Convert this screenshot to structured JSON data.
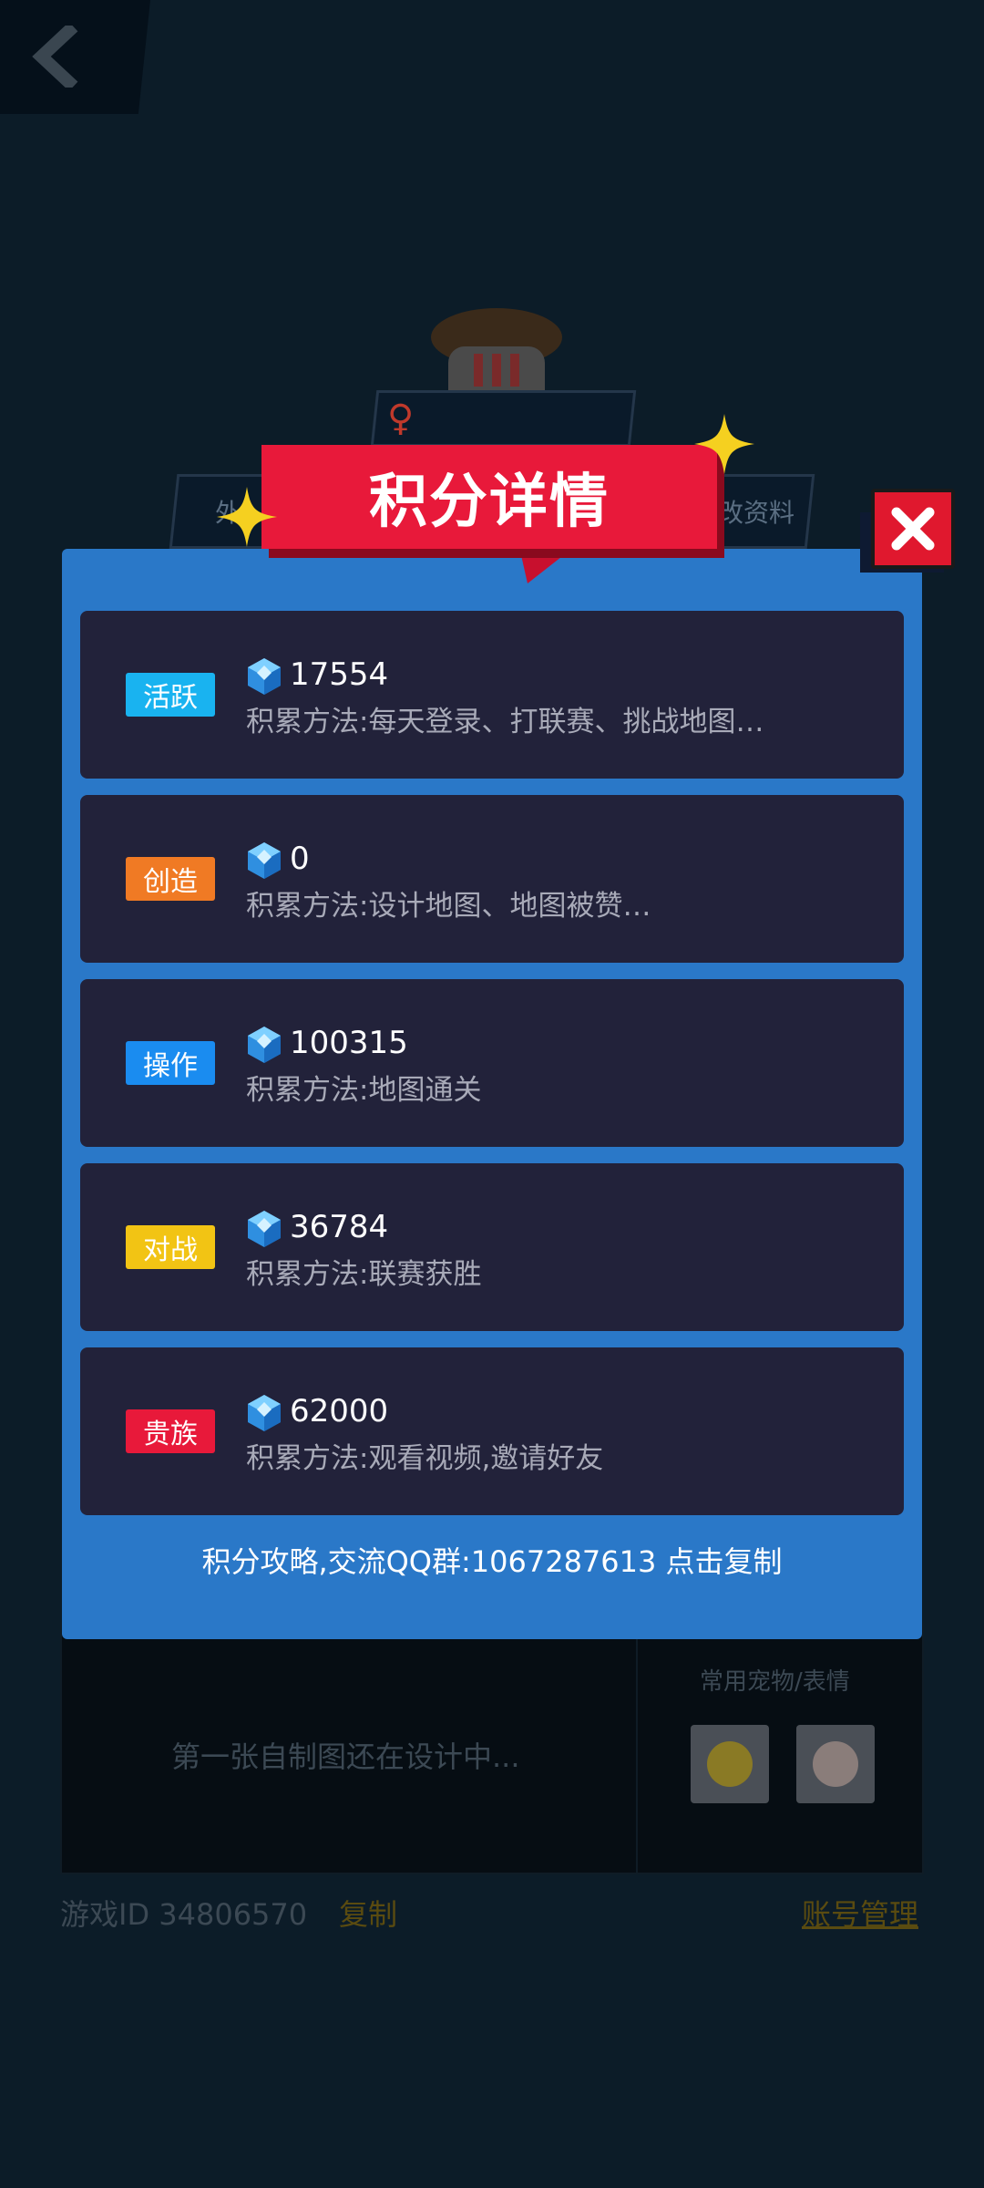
{
  "background": {
    "tabs": {
      "left_label": "外",
      "right_label": "改资料"
    },
    "card": {
      "placeholder": "第一张自制图还在设计中...",
      "pets_title": "常用宠物/表情"
    },
    "footer": {
      "game_id": "游戏ID 34806570",
      "copy_label": "复制",
      "account_label": "账号管理"
    }
  },
  "dialog": {
    "title": "积分详情",
    "items": [
      {
        "badge": "活跃",
        "badge_color": "#19b3f0",
        "points": "17554",
        "method": "积累方法:每天登录、打联赛、挑战地图…"
      },
      {
        "badge": "创造",
        "badge_color": "#f07a24",
        "points": "0",
        "method": "积累方法:设计地图、地图被赞…"
      },
      {
        "badge": "操作",
        "badge_color": "#1a8cf0",
        "points": "100315",
        "method": "积累方法:地图通关"
      },
      {
        "badge": "对战",
        "badge_color": "#f2c414",
        "points": "36784",
        "method": "积累方法:联赛获胜"
      },
      {
        "badge": "贵族",
        "badge_color": "#e8193a",
        "points": "62000",
        "method": "积累方法:观看视频,邀请好友"
      }
    ],
    "footer_link": "积分攻略,交流QQ群:1067287613 点击复制"
  }
}
